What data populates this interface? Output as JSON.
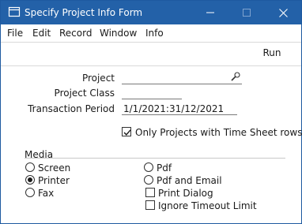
{
  "window": {
    "title": "Specify Project Info Form",
    "icon": "app-window-icon",
    "controls": [
      "minimize-icon",
      "maximize-icon",
      "close-icon"
    ],
    "accent_color": "#2361a8"
  },
  "menubar": {
    "items": [
      "File",
      "Edit",
      "Record",
      "Window",
      "Info"
    ]
  },
  "toolbar": {
    "run_label": "Run"
  },
  "form": {
    "project_label": "Project",
    "project_value": "",
    "project_icon": "paste-special-icon",
    "project_class_label": "Project Class",
    "project_class_value": "",
    "transaction_period_label": "Transaction Period",
    "transaction_period_value": "1/1/2021:31/12/2021",
    "only_projects_label": "Only Projects with Time Sheet rows",
    "only_projects_checked": true
  },
  "media": {
    "section_label": "Media",
    "options": [
      {
        "label": "Screen",
        "selected": false
      },
      {
        "label": "Printer",
        "selected": true
      },
      {
        "label": "Fax",
        "selected": false
      },
      {
        "label": "Pdf",
        "selected": false
      },
      {
        "label": "Pdf and Email",
        "selected": false
      }
    ],
    "print_dialog_label": "Print Dialog",
    "print_dialog_checked": false,
    "ignore_timeout_label": "Ignore Timeout Limit",
    "ignore_timeout_checked": false
  }
}
